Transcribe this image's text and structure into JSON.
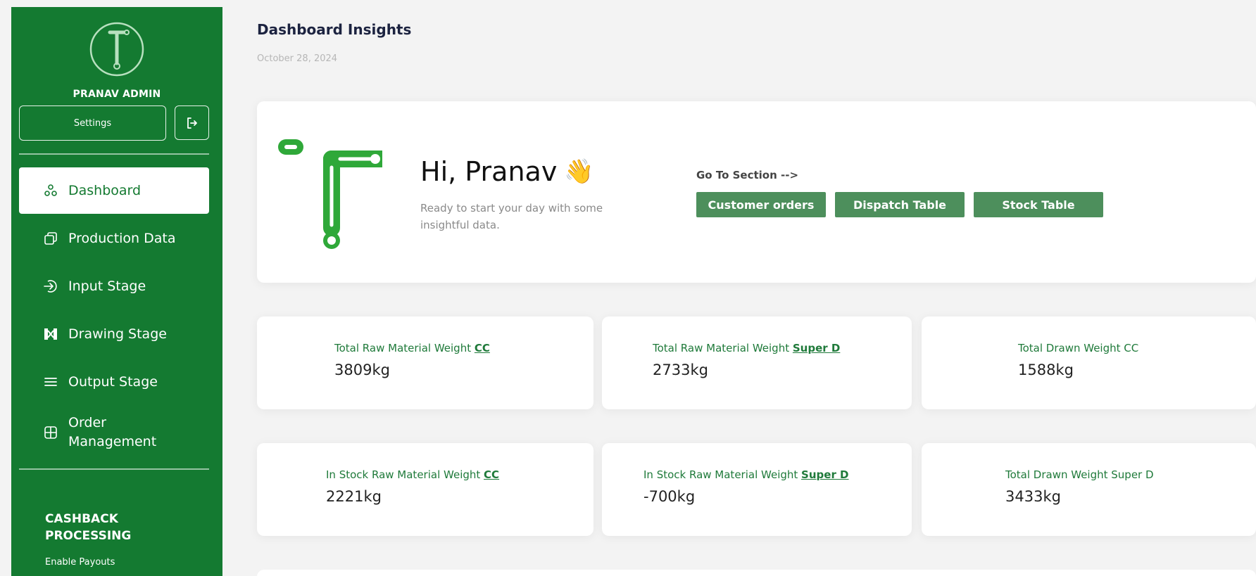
{
  "sidebar": {
    "admin_name": "PRANAV ADMIN",
    "settings_label": "Settings",
    "nav": [
      {
        "label": "Dashboard",
        "icon": "dashboard-icon",
        "active": true
      },
      {
        "label": "Production Data",
        "icon": "copy-icon",
        "active": false
      },
      {
        "label": "Input Stage",
        "icon": "arrow-in-icon",
        "active": false
      },
      {
        "label": "Drawing Stage",
        "icon": "drawing-icon",
        "active": false
      },
      {
        "label": "Output Stage",
        "icon": "menu-icon",
        "active": false
      },
      {
        "label_line1": "Order",
        "label_line2": "Management",
        "icon": "grid-icon",
        "active": false
      }
    ],
    "cashback_title_line1": "CASHBACK",
    "cashback_title_line2": "PROCESSING",
    "cashback_sub": "Enable Payouts"
  },
  "header": {
    "title": "Dashboard Insights",
    "date": "October 28, 2024"
  },
  "hero": {
    "greeting": "Hi, Pranav",
    "wave": "👋",
    "subtitle": "Ready to start your day with some insightful data.",
    "goto_label": "Go To Section -->",
    "buttons": [
      "Customer orders",
      "Dispatch Table",
      "Stock Table"
    ]
  },
  "stats": [
    {
      "label": "Total Raw Material Weight",
      "emph": "CC",
      "value": "3809kg"
    },
    {
      "label": "Total Raw Material Weight",
      "emph": "Super D",
      "value": "2733kg"
    },
    {
      "label": "Total Drawn Weight CC",
      "emph": "",
      "value": "1588kg"
    },
    {
      "label": "In Stock Raw Material Weight",
      "emph": "CC",
      "value": "2221kg"
    },
    {
      "label": "In Stock Raw Material Weight",
      "emph": "Super D",
      "value": "-700kg"
    },
    {
      "label": "Total Drawn Weight Super D",
      "emph": "",
      "value": "3433kg"
    }
  ],
  "colors": {
    "brand_green": "#147a31",
    "button_green": "#4d8f5c",
    "logo_green": "#2fa839"
  }
}
